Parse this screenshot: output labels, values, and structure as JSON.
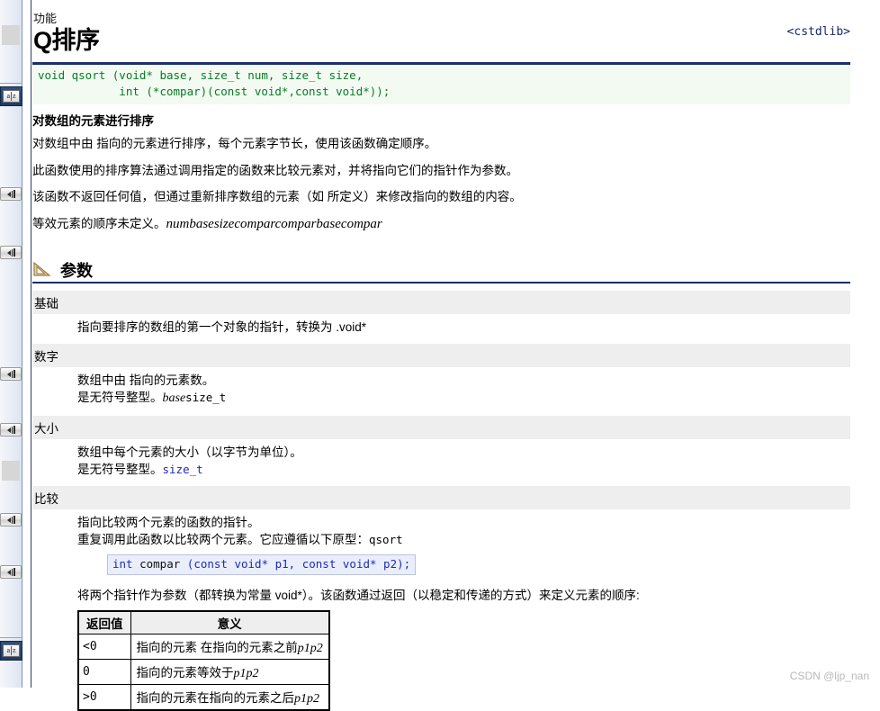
{
  "page": {
    "kicker": "功能",
    "title": "Q排序",
    "header_link": "<cstdlib>",
    "watermark": "CSDN @ljp_nan",
    "accent_color": "#1a2f6b",
    "code_color": "#0a7a28",
    "inline_code_color": "#1b2bbd",
    "band_color": "#eeeeee"
  },
  "signature": {
    "line1": "void qsort (void* base, size_t num, size_t size,",
    "line2": "            int (*compar)(const void*,const void*));"
  },
  "intro": {
    "subhead": "对数组的元素进行排序",
    "p1": "对数组中由 指向的元素进行排序，每个元素字节长，使用该函数确定顺序。",
    "p2": "此函数使用的排序算法通过调用指定的函数来比较元素对，并将指向它们的指针作为参数。",
    "p3": "该函数不返回任何值，但通过重新排序数组的元素（如 所定义）来修改指向的数组的内容。",
    "p4_text": "等效元素的顺序未定义。",
    "p4_italic": "numbasesizecomparcomparbasecompar"
  },
  "parameters_section": {
    "icon": "ruler-triangle-icon",
    "title": "参数",
    "items": [
      {
        "name": "基础",
        "lines": [
          "指向要排序的数组的第一个对象的指针，转换为 .void*"
        ],
        "mono_tail": ""
      },
      {
        "name": "数字",
        "lines": [
          "数组中由 指向的元素数。",
          "是无符号整型。"
        ],
        "italic_tail": "base",
        "mono_tail": "size_t"
      },
      {
        "name": "大小",
        "lines": [
          "数组中每个元素的大小（以字节为单位）。",
          "是无符号整型。"
        ],
        "mono_tail": "size_t"
      },
      {
        "name": "比较",
        "lines": [
          "指向比较两个元素的函数的指针。",
          "重复调用此函数以比较两个元素。它应遵循以下原型："
        ],
        "mono_tail": "qsort"
      }
    ]
  },
  "compar_prototype": {
    "kw1": "int",
    "id1": " compar ",
    "rest": "(const void* p1, const void* p2);"
  },
  "compar_note": "将两个指针作为参数（都转换为常量 void*）。该函数通过返回（以稳定和传递的方式）来定义元素的顺序:",
  "return_table": {
    "headers": [
      "返回值",
      "意义"
    ],
    "rows": [
      {
        "value": "<0",
        "meaning": "指向的元素 在指向的元素之前",
        "meaning_italic": "p1p2"
      },
      {
        "value": "0",
        "meaning": "指向的元素等效于",
        "meaning_italic": "p1p2"
      },
      {
        "value": ">0",
        "meaning": "指向的元素在指向的元素之后",
        "meaning_italic": "p1p2"
      }
    ]
  },
  "left_strip": {
    "translate_icon_top": "translate-az-icon",
    "translate_icon_bottom": "translate-az-icon",
    "a_label": "a",
    "z_label": "z",
    "handle_count": 6
  }
}
